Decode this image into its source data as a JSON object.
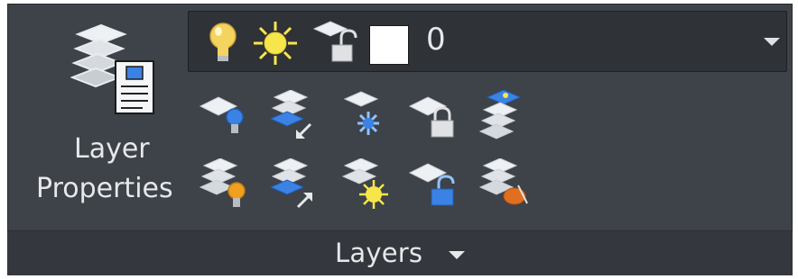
{
  "panel": {
    "title": "Layers",
    "title_dropdown_icon": "triangle-down-icon"
  },
  "layer_properties": {
    "label_line1": "Layer",
    "label_line2": "Properties",
    "icon": "layer-properties-icon"
  },
  "current_layer": {
    "name": "0",
    "icons": [
      "lightbulb-on-icon",
      "sun-thawed-icon",
      "padlock-open-icon"
    ],
    "color": "#ffffff",
    "dropdown_icon": "triangle-down-icon"
  },
  "tool_rows": [
    [
      "layer-off-icon",
      "match-layer-icon",
      "layer-freeze-icon",
      "layer-lock-icon",
      "make-current-layer-icon"
    ],
    [
      "layer-on-icon",
      "layer-set-current-icon",
      "layer-thaw-icon",
      "layer-unlock-icon",
      "layer-delete-icon"
    ]
  ],
  "colors": {
    "panel_bg": "#3e4249",
    "footer_bg": "#34373d",
    "combo_bg": "#2f3237",
    "text": "#e6e8ea",
    "accent_blue": "#3b82e4",
    "bulb_yellow": "#f4d35e",
    "sun_yellow": "#f7e64a",
    "orange": "#f0a020"
  }
}
